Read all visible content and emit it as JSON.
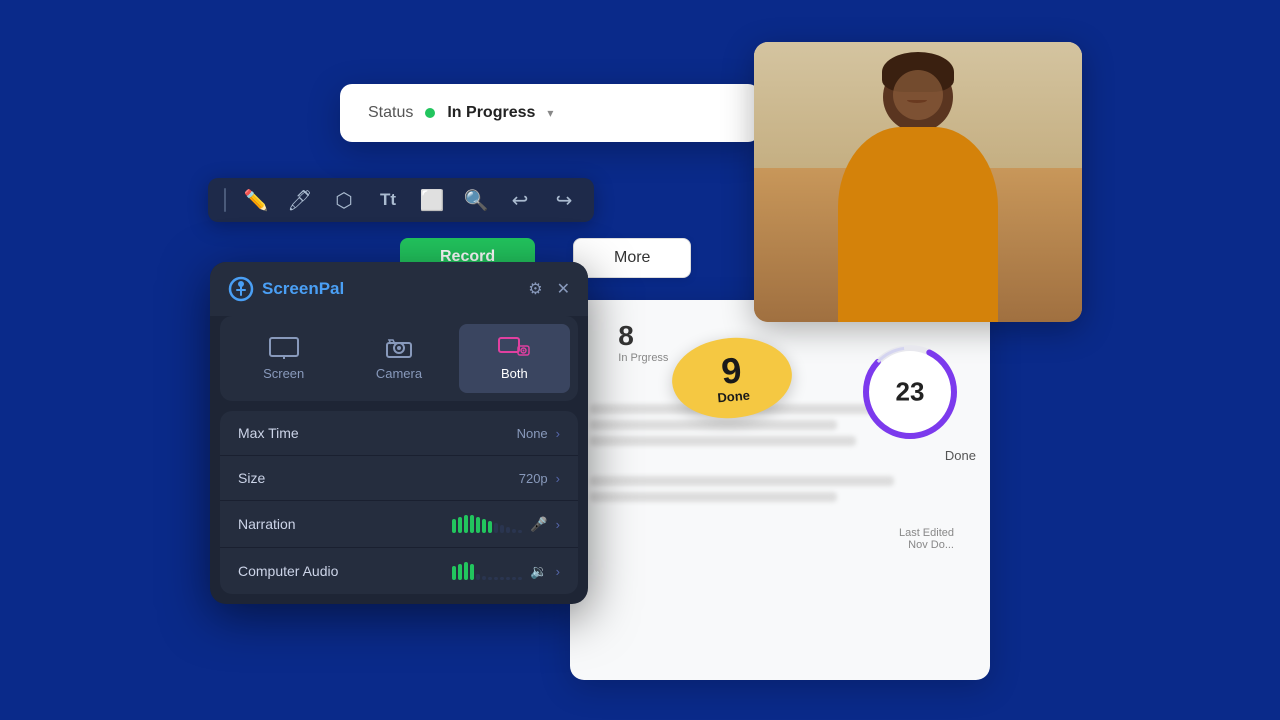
{
  "background": {
    "color": "#0a2a8a"
  },
  "status_card": {
    "label": "Status",
    "dot_color": "#22c55e",
    "value": "In Progress",
    "chevron": "▾"
  },
  "toolbar": {
    "icons": [
      "draw",
      "highlight",
      "erase",
      "text",
      "rect",
      "zoom",
      "undo",
      "redo"
    ]
  },
  "more_button": {
    "label": "More"
  },
  "green_button": {
    "label": "Record"
  },
  "yellow_badge": {
    "number": "9",
    "label": "Done"
  },
  "circle_badge": {
    "number": "23",
    "label": "Done"
  },
  "stats": {
    "in_progress_num": "8",
    "in_progress_label": "rgress",
    "last_edited_label": "Last Edited",
    "last_edited_value": "Nov Do"
  },
  "screenpal": {
    "logo_text_1": "Screen",
    "logo_text_2": "Pal",
    "modes": [
      {
        "id": "screen",
        "label": "Screen",
        "active": false
      },
      {
        "id": "camera",
        "label": "Camera",
        "active": false
      },
      {
        "id": "both",
        "label": "Both",
        "active": true
      }
    ],
    "settings": [
      {
        "label": "Max Time",
        "value": "None"
      },
      {
        "label": "Size",
        "value": "720p"
      },
      {
        "label": "Narration",
        "value": "",
        "bars": [
          7,
          9,
          10,
          10,
          9,
          8,
          7,
          6,
          4,
          3,
          2,
          1
        ]
      },
      {
        "label": "Computer Audio",
        "value": "",
        "bars": [
          7,
          8,
          9,
          8,
          7,
          3,
          2,
          1,
          1,
          1,
          1,
          1
        ]
      }
    ]
  }
}
